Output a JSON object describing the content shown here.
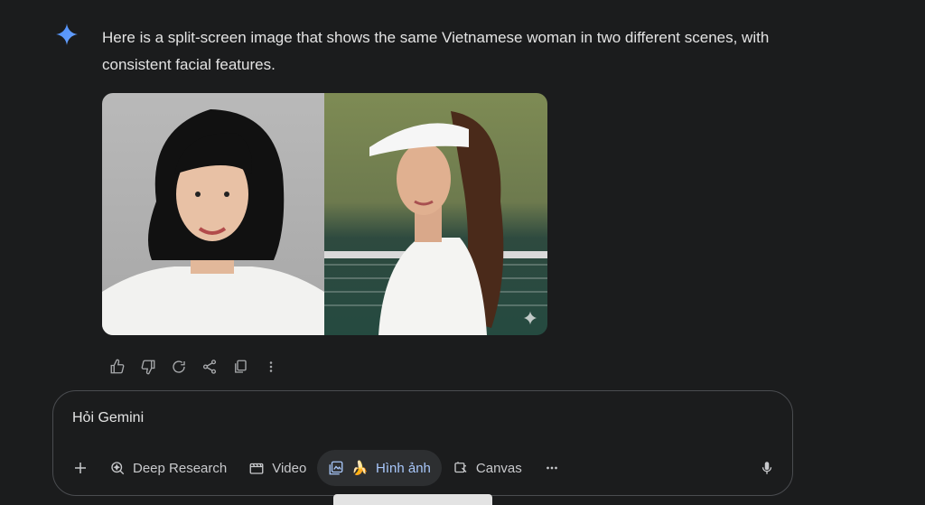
{
  "message": {
    "text": "Here is a split-screen image that shows the same Vietnamese woman in two different scenes, with consistent facial features."
  },
  "image": {
    "left_scene": "portrait-gray-background",
    "right_scene": "tennis-court-visor"
  },
  "actions": [
    {
      "icon": "thumbs-up-icon"
    },
    {
      "icon": "thumbs-down-icon"
    },
    {
      "icon": "redo-icon"
    },
    {
      "icon": "share-icon"
    },
    {
      "icon": "copy-icon"
    },
    {
      "icon": "more-vert-icon"
    }
  ],
  "composer": {
    "placeholder": "Hỏi Gemini",
    "tools": {
      "deep_research": "Deep Research",
      "video": "Video",
      "image": "Hình ảnh",
      "canvas": "Canvas"
    }
  },
  "colors": {
    "background": "#1b1c1d",
    "accent": "#a8c7fa",
    "sparkle": "#4c8df6"
  }
}
